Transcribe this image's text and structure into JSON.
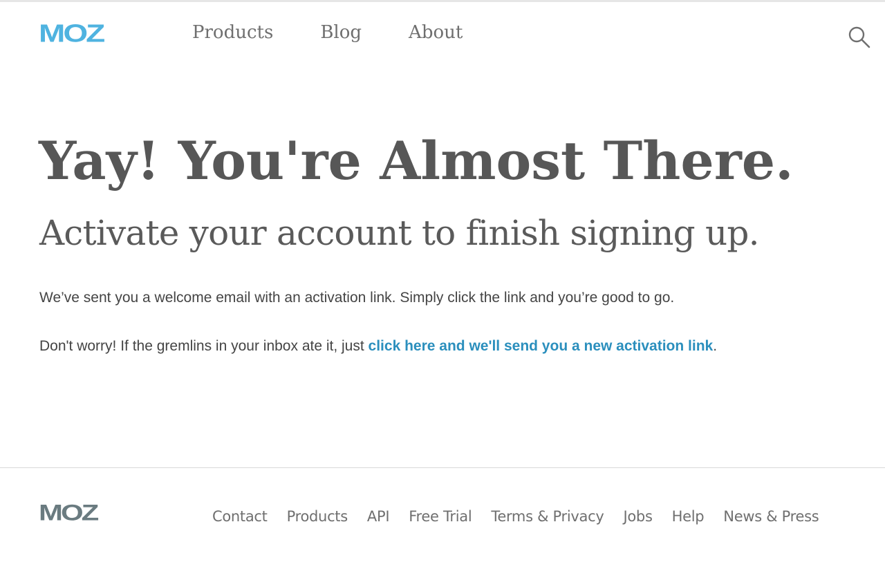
{
  "header": {
    "logo_text": "MOZ",
    "nav": [
      {
        "label": "Products"
      },
      {
        "label": "Blog"
      },
      {
        "label": "About"
      }
    ],
    "search_icon": "search-icon"
  },
  "main": {
    "headline": "Yay! You're Almost There.",
    "subheadline": "Activate your account to finish signing up.",
    "paragraph1": "We’ve sent you a welcome email with an activation link. Simply click the link and you’re good to go.",
    "paragraph2_prefix": "Don't worry! If the gremlins in your inbox ate it, just ",
    "paragraph2_link": "click here and we'll send you a new activation link",
    "paragraph2_suffix": "."
  },
  "footer": {
    "logo_text": "MOZ",
    "links": [
      {
        "label": "Contact"
      },
      {
        "label": "Products"
      },
      {
        "label": "API"
      },
      {
        "label": "Free Trial"
      },
      {
        "label": "Terms & Privacy"
      },
      {
        "label": "Jobs"
      },
      {
        "label": "Help"
      },
      {
        "label": "News & Press"
      }
    ]
  },
  "colors": {
    "brand_blue": "#4fb3e0",
    "link_blue": "#2b8fbd",
    "footer_logo_gray": "#6a7b80",
    "text_gray": "#555555"
  }
}
